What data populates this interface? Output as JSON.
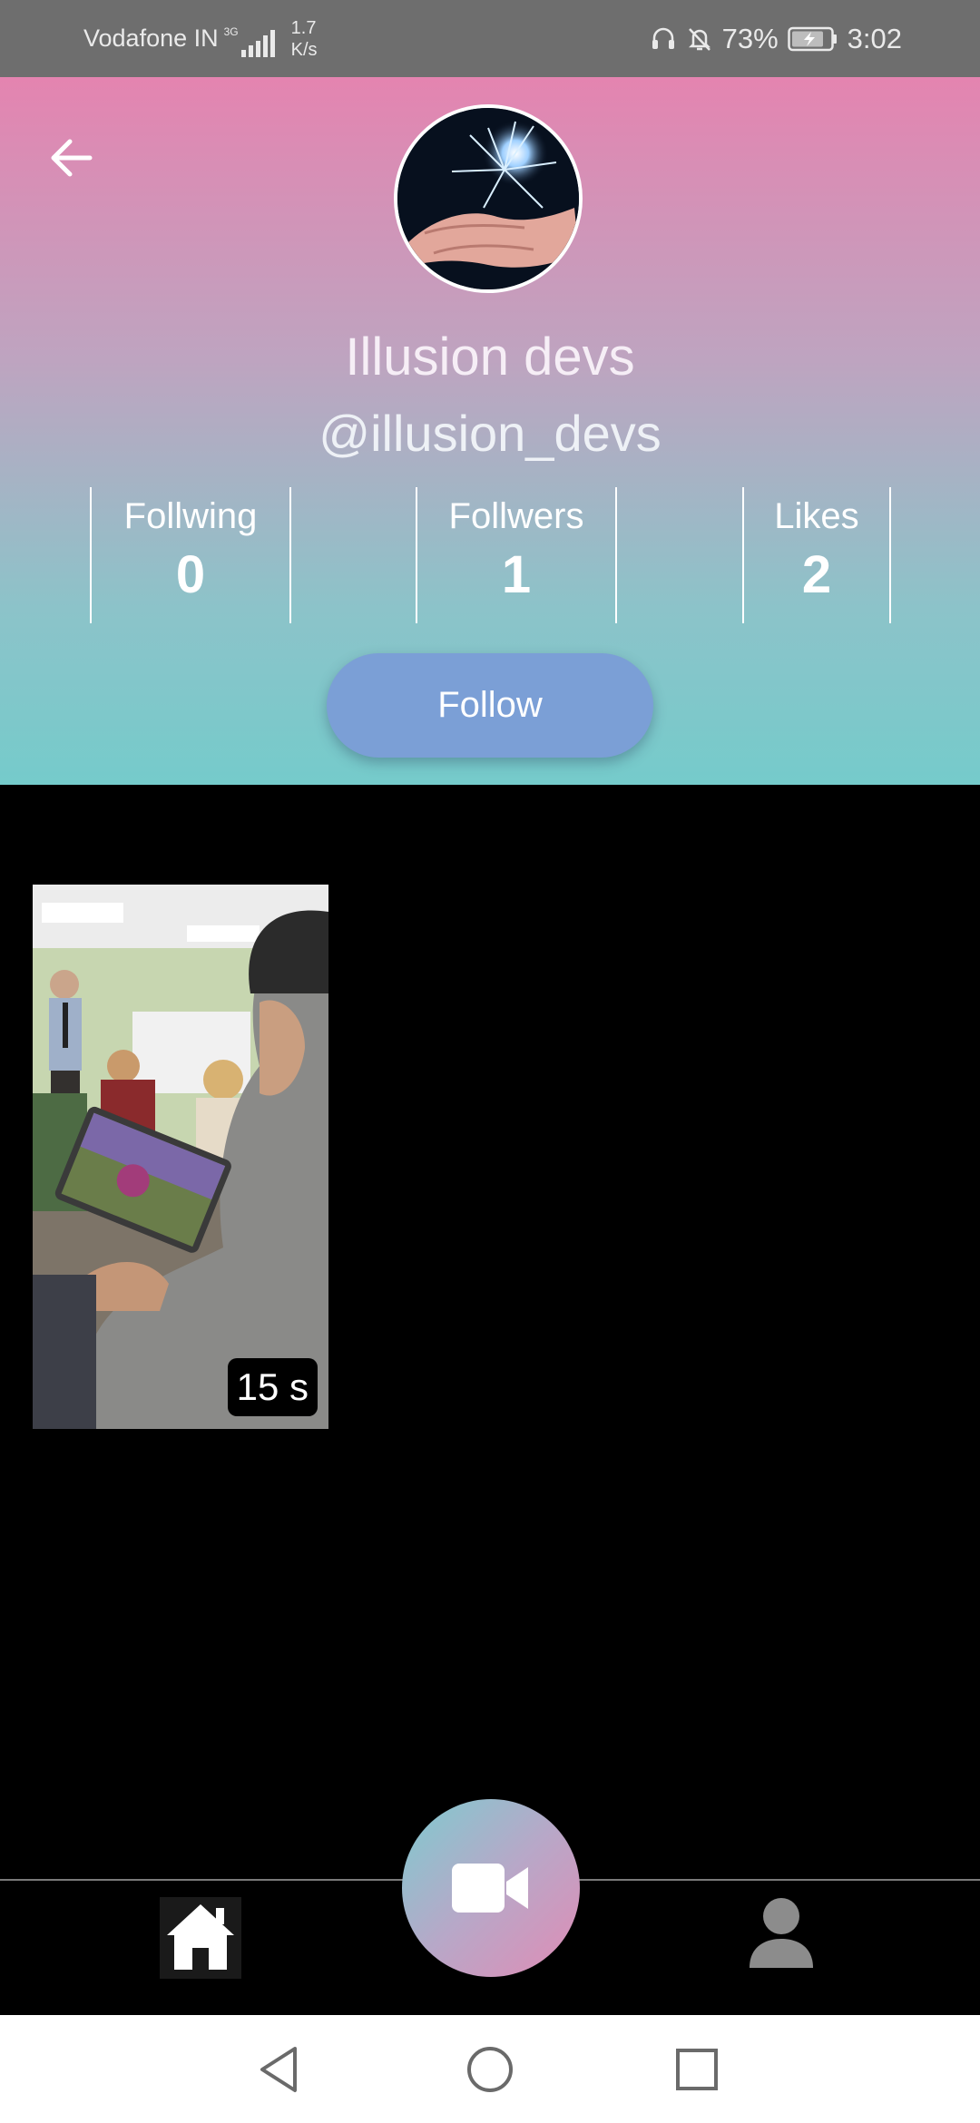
{
  "status_bar": {
    "carrier": "Vodafone IN",
    "network_type": "3G",
    "net_speed_value": "1.7",
    "net_speed_unit": "K/s",
    "battery_percent": "73%",
    "time": "3:02",
    "icons": [
      "headphones-icon",
      "notifications-off-icon",
      "battery-charging-icon"
    ]
  },
  "profile": {
    "display_name": "Illusion devs",
    "username": "@illusion_devs",
    "avatar_icon": "avatar-image",
    "stats": [
      {
        "label": "Follwing",
        "value": "0"
      },
      {
        "label": "Follwers",
        "value": "1"
      },
      {
        "label": "Likes",
        "value": "2"
      }
    ],
    "follow_label": "Follow",
    "back_icon": "arrow-back-icon"
  },
  "videos": [
    {
      "duration": "15 s"
    }
  ],
  "bottom_nav": {
    "items": [
      "home-icon",
      "video-camera-icon",
      "profile-icon"
    ]
  },
  "system_nav": {
    "items": [
      "back-triangle-icon",
      "home-circle-icon",
      "recents-square-icon"
    ]
  },
  "colors": {
    "header_gradient_top": "#e484b0",
    "header_gradient_bottom": "#75cbcb",
    "follow_button": "#7b9fd6",
    "record_gradient": [
      "#7ecbcf",
      "#e08cb5"
    ]
  }
}
